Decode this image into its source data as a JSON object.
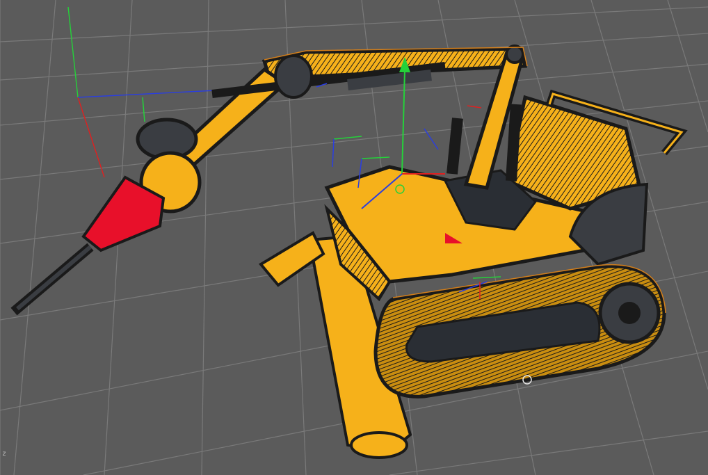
{
  "viewport": {
    "axis_label": "z"
  },
  "colors": {
    "background": "#5b5b5b",
    "grid": "#7a7a7a",
    "body_yellow": "#f6b11a",
    "outline": "#1a1a1a",
    "hammer_red": "#e8102a",
    "selection_orange": "#e88a1a",
    "axis_y_green": "#25d13a",
    "axis_x_red": "#e02020",
    "axis_z_blue": "#2a3ee0"
  },
  "icons": {
    "cursor": "circle-cursor-icon",
    "gizmo": "move-gizmo-icon"
  }
}
